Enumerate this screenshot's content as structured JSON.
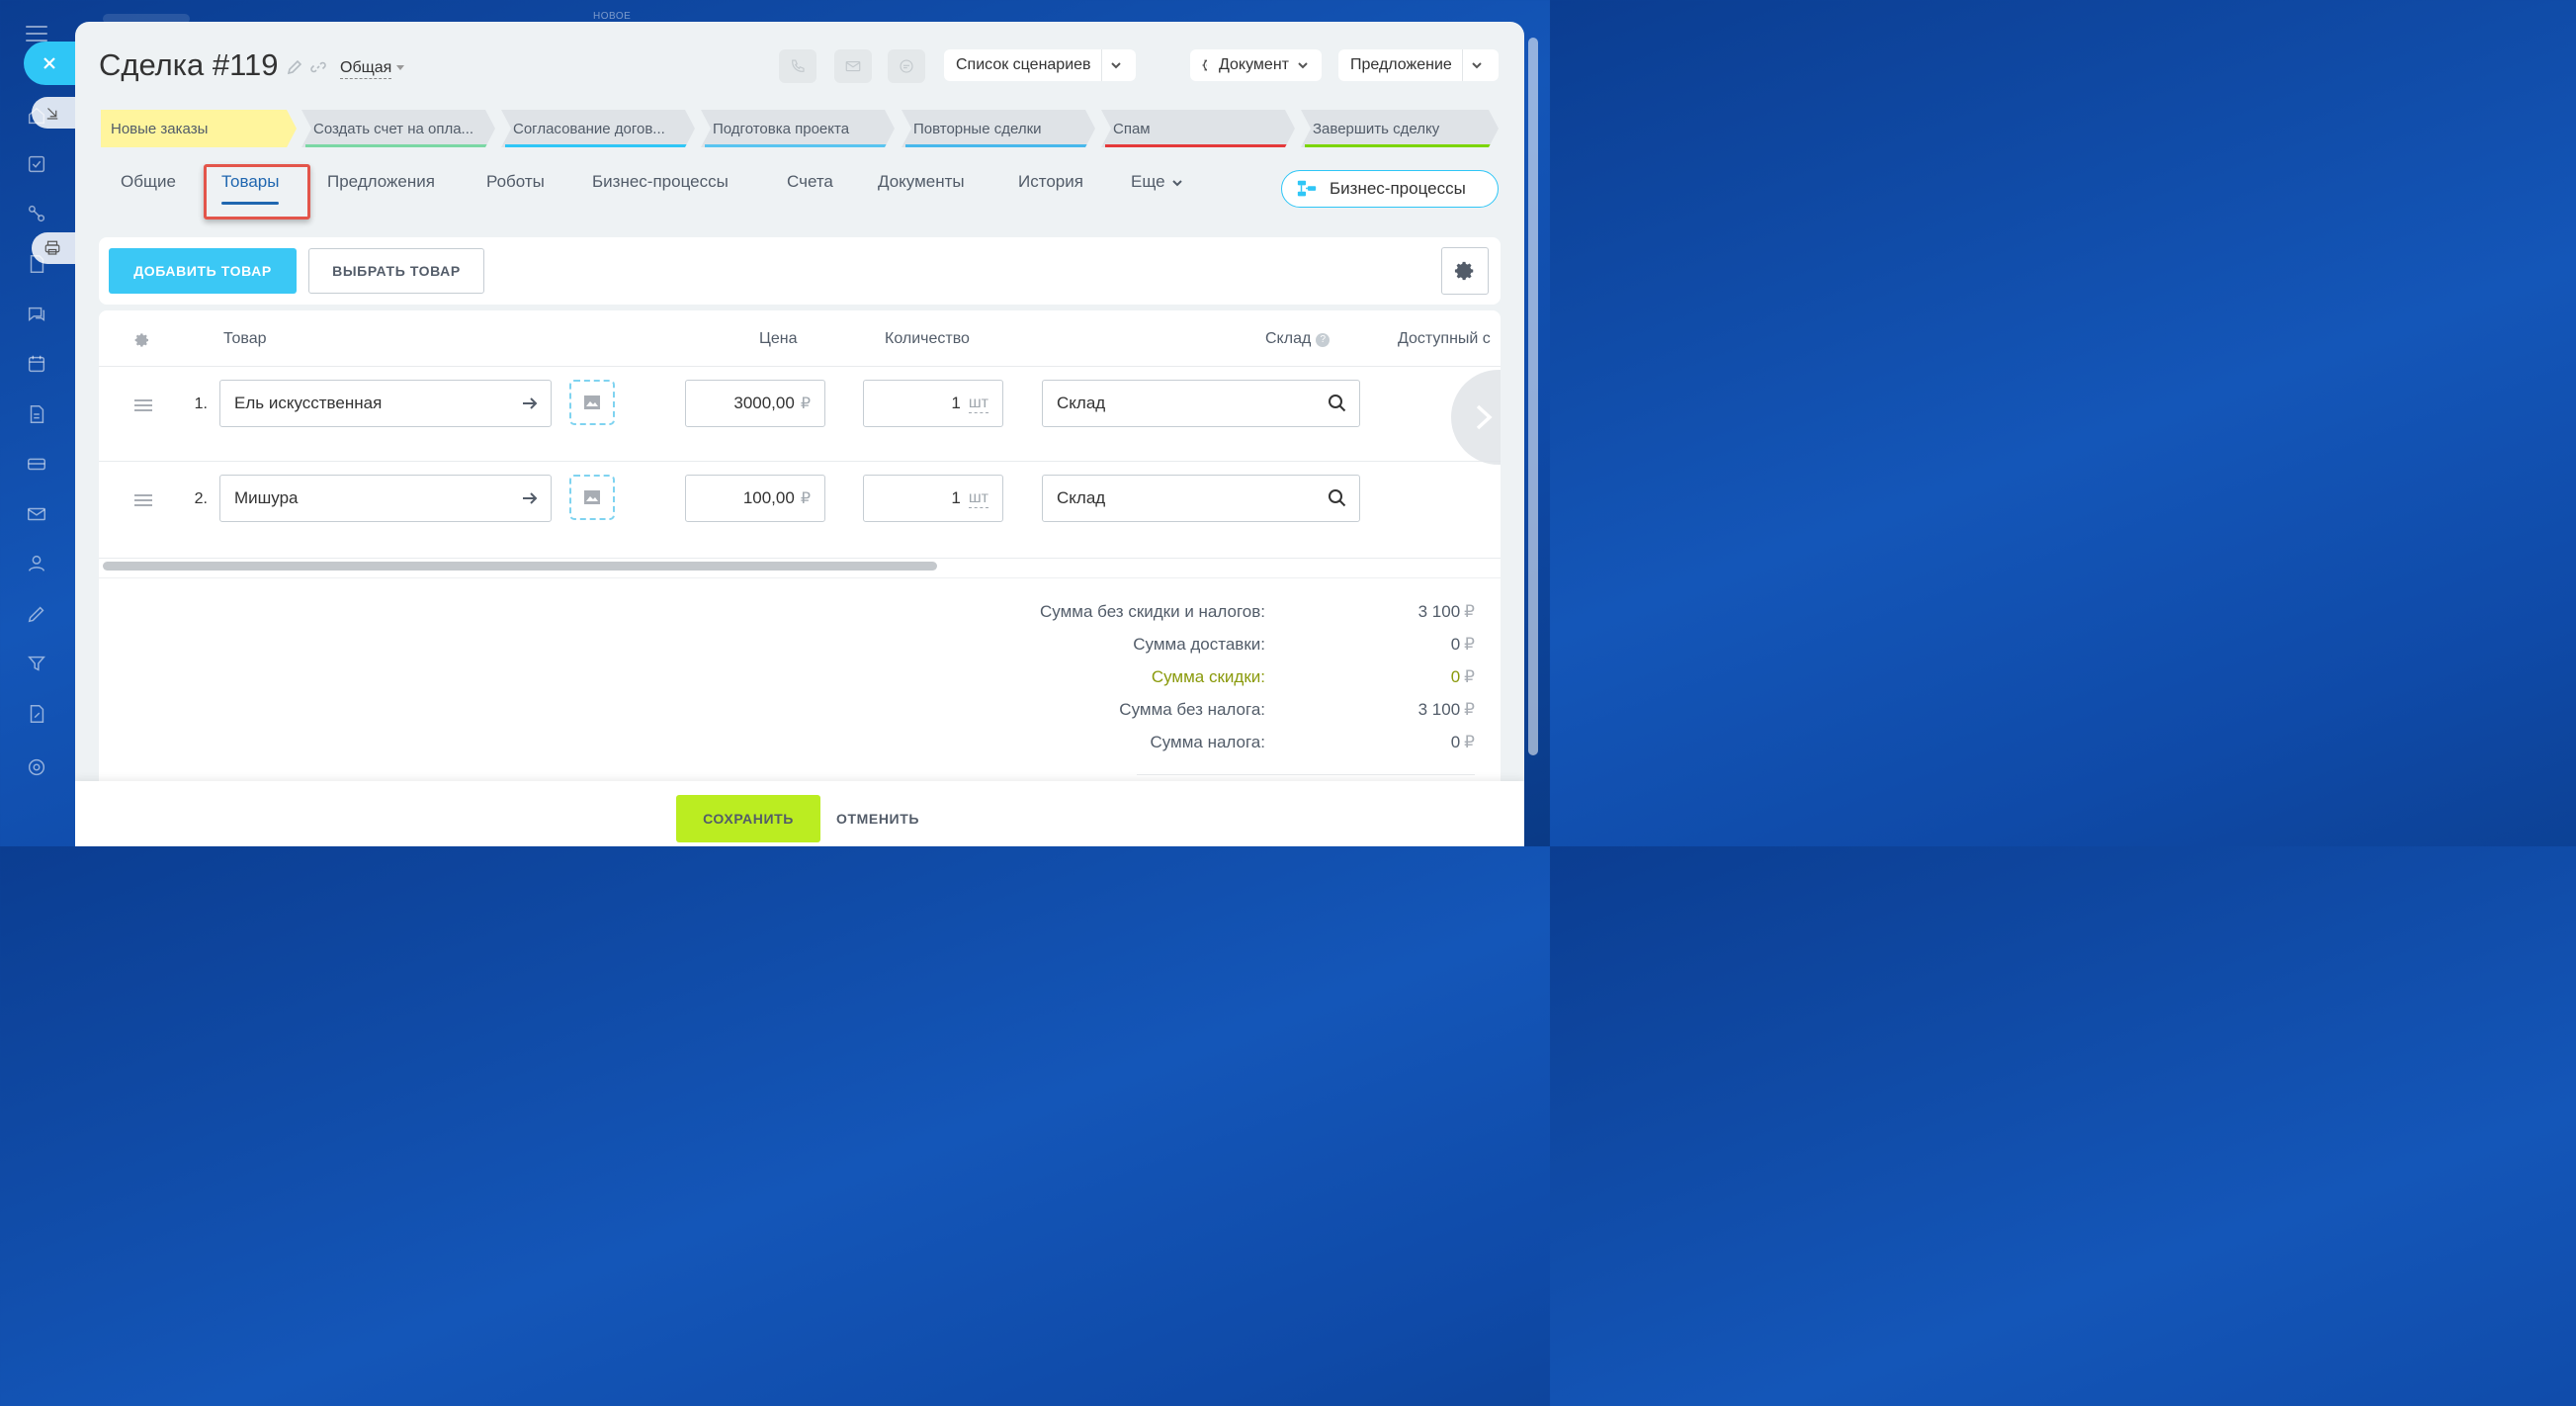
{
  "window": {
    "top_label": "НОВОЕ"
  },
  "header": {
    "title": "Сделка #119",
    "category": "Общая",
    "scenarios_button": "Список сценариев",
    "document_button": "Документ",
    "offer_button": "Предложение"
  },
  "stages": [
    {
      "label": "Новые заказы",
      "color": "#fff59d",
      "bar": "#fff59d"
    },
    {
      "label": "Создать счет на опла...",
      "color": "#dfe3e7",
      "bar": "#7ad7a4"
    },
    {
      "label": "Согласование догов...",
      "color": "#dfe3e7",
      "bar": "#2fc6f6"
    },
    {
      "label": "Подготовка проекта",
      "color": "#dfe3e7",
      "bar": "#59c4f0"
    },
    {
      "label": "Повторные сделки",
      "color": "#dfe3e7",
      "bar": "#47b8ec"
    },
    {
      "label": "Спам",
      "color": "#dfe3e7",
      "bar": "#e5393a"
    },
    {
      "label": "Завершить сделку",
      "color": "#dfe3e7",
      "bar": "#7bd500"
    }
  ],
  "tabs": [
    {
      "label": "Общие"
    },
    {
      "label": "Товары",
      "active": true
    },
    {
      "label": "Предложения"
    },
    {
      "label": "Роботы"
    },
    {
      "label": "Бизнес-процессы"
    },
    {
      "label": "Счета"
    },
    {
      "label": "Документы"
    },
    {
      "label": "История"
    },
    {
      "label": "Еще"
    }
  ],
  "bp_button": "Бизнес-процессы",
  "toolbar": {
    "add_label": "ДОБАВИТЬ ТОВАР",
    "choose_label": "ВЫБРАТЬ ТОВАР"
  },
  "table": {
    "columns": {
      "product": "Товар",
      "price": "Цена",
      "quantity": "Количество",
      "warehouse": "Склад",
      "available": "Доступный с"
    },
    "rows": [
      {
        "num": "1.",
        "name": "Ель искусственная",
        "price": "3000,00",
        "currency": "₽",
        "qty": "1",
        "unit": "шт",
        "warehouse": "Склад"
      },
      {
        "num": "2.",
        "name": "Мишура",
        "price": "100,00",
        "currency": "₽",
        "qty": "1",
        "unit": "шт",
        "warehouse": "Склад"
      }
    ]
  },
  "totals": [
    {
      "label": "Сумма без скидки и налогов:",
      "value": "3 100",
      "currency": "₽"
    },
    {
      "label": "Сумма доставки:",
      "value": "0",
      "currency": "₽"
    },
    {
      "label": "Сумма скидки:",
      "value": "0",
      "currency": "₽",
      "discount": true
    },
    {
      "label": "Сумма без налога:",
      "value": "3 100",
      "currency": "₽"
    },
    {
      "label": "Сумма налога:",
      "value": "0",
      "currency": "₽"
    }
  ],
  "footer": {
    "save_label": "СОХРАНИТЬ",
    "cancel_label": "ОТМЕНИТЬ"
  }
}
